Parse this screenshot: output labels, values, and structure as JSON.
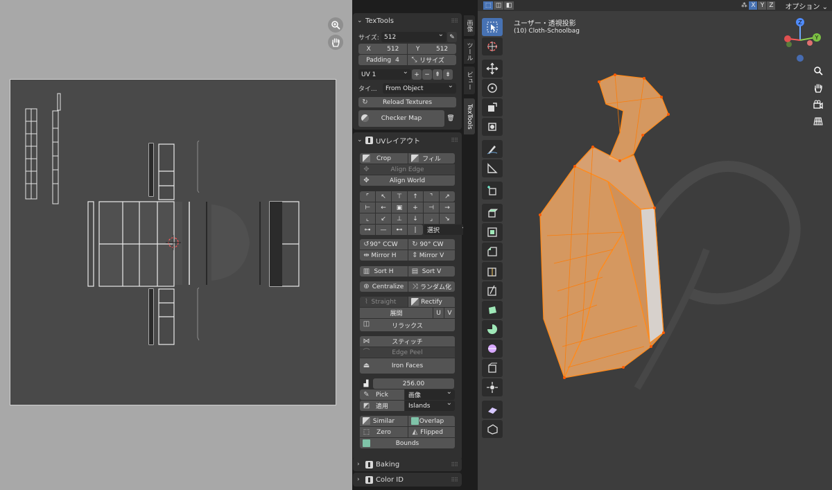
{
  "uv_editor": {
    "zoom_icon": "zoom-icon",
    "pan_icon": "hand-pan-icon"
  },
  "texture_panel": {
    "title": "TexTools",
    "size_label": "サイズ:",
    "size_value": "512",
    "x_label": "X",
    "x_value": "512",
    "y_label": "Y",
    "y_value": "512",
    "padding_label": "Padding",
    "padding_value": "4",
    "resize_label": "リサイズ",
    "uv_channel": "UV 1",
    "type_label": "タイ...",
    "type_value": "From Object",
    "reload_label": "Reload Textures",
    "checker_label": "Checker Map"
  },
  "layout_panel": {
    "title": "UVレイアウト",
    "crop": "Crop",
    "fill": "フィル",
    "align_edge": "Align Edge",
    "align_world": "Align World",
    "select_value": "選択",
    "rot_ccw": "90° CCW",
    "rot_cw": "90° CW",
    "mirror_h": "Mirror H",
    "mirror_v": "Mirror V",
    "sort_h": "Sort H",
    "sort_v": "Sort V",
    "centralize": "Centralize",
    "randomize": "ランダム化",
    "straight": "Straight",
    "rectify": "Rectify",
    "unwrap": "展開",
    "u": "U",
    "v": "V",
    "relax": "リラックス",
    "stitch": "スティッチ",
    "edge_peel": "Edge Peel",
    "iron_faces": "Iron Faces",
    "texel_value": "256.00",
    "pick": "Pick",
    "pick_mode": "画像",
    "apply": "適用",
    "apply_mode": "Islands",
    "similar": "Similar",
    "overlap": "Overlap",
    "zero": "Zero",
    "flipped": "Flipped",
    "bounds": "Bounds"
  },
  "collapsed_panels": {
    "baking": "Baking",
    "color_id": "Color ID"
  },
  "side_tabs": [
    "画像",
    "ツール",
    "ビュー",
    "TexTools"
  ],
  "viewport": {
    "view_name": "ユーザー・透視投影",
    "object_name": "(10) Cloth-Schoolbag",
    "axis_x": "X",
    "axis_y": "Y",
    "axis_z": "Z",
    "options_label": "オプション",
    "gizmo_z": "Z",
    "gizmo_y": "Y",
    "active_tool": "select-box-icon"
  },
  "colors": {
    "accent_blue": "#4772b3",
    "selection_orange": "#ff8a1a",
    "panel_bg": "#303030",
    "button_bg": "#545454"
  }
}
